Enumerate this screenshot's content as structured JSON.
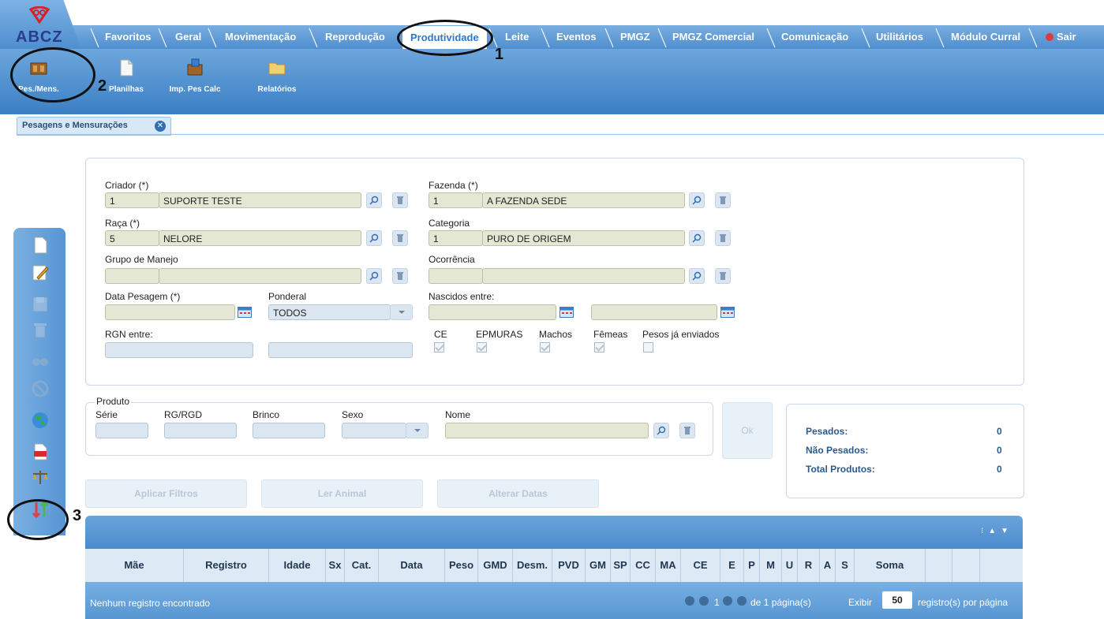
{
  "logo": {
    "text": "ABCZ"
  },
  "nav": {
    "tabs": [
      {
        "label": "Favoritos"
      },
      {
        "label": "Geral"
      },
      {
        "label": "Movimentação"
      },
      {
        "label": "Reprodução"
      },
      {
        "label": "Produtividade",
        "active": true
      },
      {
        "label": "Leite"
      },
      {
        "label": "Eventos"
      },
      {
        "label": "PMGZ"
      },
      {
        "label": "PMGZ Comercial"
      },
      {
        "label": "Comunicação"
      },
      {
        "label": "Utilitários"
      },
      {
        "label": "Módulo Curral"
      }
    ],
    "exit_label": "Sair"
  },
  "ribbon": {
    "buttons": [
      {
        "label": "Pes./Mens.",
        "icon": "scale-box-icon"
      },
      {
        "label": "Planilhas",
        "icon": "document-icon"
      },
      {
        "label": "Imp. Pes Calc",
        "icon": "import-calc-icon"
      },
      {
        "label": "Relatórios",
        "icon": "folder-icon"
      }
    ]
  },
  "page_tab": {
    "label": "Pesagens e Mensurações"
  },
  "annotations": {
    "n1": "1",
    "n2": "2",
    "n3": "3"
  },
  "form": {
    "criador": {
      "label": "Criador (*)",
      "code": "1",
      "name": "SUPORTE TESTE"
    },
    "fazenda": {
      "label": "Fazenda (*)",
      "code": "1",
      "name": "A FAZENDA SEDE"
    },
    "raca": {
      "label": "Raça (*)",
      "code": "5",
      "name": "NELORE"
    },
    "categoria": {
      "label": "Categoria",
      "code": "1",
      "name": "PURO DE ORIGEM"
    },
    "grupo_manejo": {
      "label": "Grupo de Manejo",
      "code": "",
      "name": ""
    },
    "ocorrencia": {
      "label": "Ocorrência",
      "code": "",
      "name": ""
    },
    "data_pesagem": {
      "label": "Data Pesagem (*)",
      "value": ""
    },
    "ponderal": {
      "label": "Ponderal",
      "value": "TODOS"
    },
    "nascidos_entre": {
      "label": "Nascidos entre:",
      "from": "",
      "to": ""
    },
    "rgn_entre": {
      "label": "RGN entre:",
      "from": "",
      "to": ""
    },
    "checks": [
      {
        "label": "CE",
        "checked": true
      },
      {
        "label": "EPMURAS",
        "checked": true
      },
      {
        "label": "Machos",
        "checked": true
      },
      {
        "label": "Fêmeas",
        "checked": true
      },
      {
        "label": "Pesos já enviados",
        "checked": false
      }
    ]
  },
  "produto": {
    "legend": "Produto",
    "serie": "Série",
    "rg": "RG/RGD",
    "brinco": "Brinco",
    "sexo": "Sexo",
    "nome": "Nome",
    "ok_label": "Ok"
  },
  "summary": {
    "pesados_label": "Pesados:",
    "pesados": "0",
    "nao_pesados_label": "Não Pesados:",
    "nao_pesados": "0",
    "total_label": "Total Produtos:",
    "total": "0"
  },
  "actions": {
    "aplicar": "Aplicar Filtros",
    "ler": "Ler Animal",
    "alterar": "Alterar Datas"
  },
  "grid": {
    "columns": [
      "Mãe",
      "Registro",
      "Idade",
      "Sx",
      "Cat.",
      "Data",
      "Peso",
      "GMD",
      "Desm.",
      "PVD",
      "GM",
      "SP",
      "CC",
      "MA",
      "CE",
      "E",
      "P",
      "M",
      "U",
      "R",
      "A",
      "S",
      "Soma"
    ],
    "empty_text": "Nenhum registro encontrado",
    "pager": {
      "page": "1",
      "of_text": "de 1 página(s)",
      "show_label": "Exibir",
      "per_page": "50",
      "per_page_suffix": "registro(s) por página"
    }
  },
  "colors": {
    "nav_blue": "#4f8ecf",
    "active_text": "#2f79c6",
    "input_bg": "#e6e6d5",
    "value_blue": "#2a5a8c"
  }
}
